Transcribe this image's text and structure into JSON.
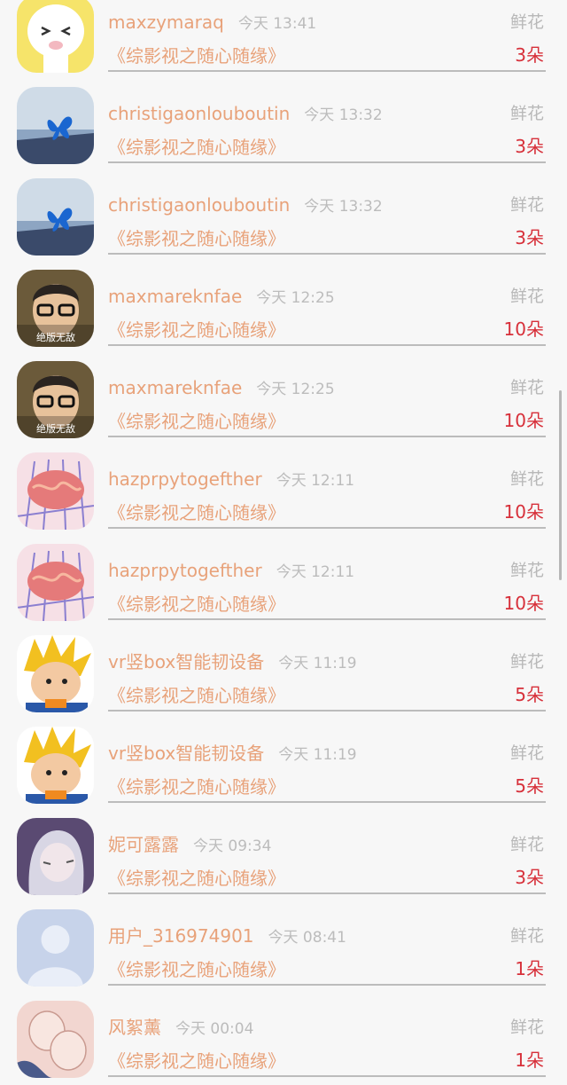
{
  "gifts": [
    {
      "name": "maxzymaraq",
      "time": "今天 13:41",
      "type": "鲜花",
      "work": "《综影视之随心随缘》",
      "count": "3朵",
      "avatar_icon": "cartoon-cat-avatar",
      "colors": [
        "#f6e46a",
        "#ffffff"
      ]
    },
    {
      "name": "christigaonlouboutin",
      "time": "今天 13:32",
      "type": "鲜花",
      "work": "《综影视之随心随缘》",
      "count": "3朵",
      "avatar_icon": "blue-butterfly-avatar",
      "colors": [
        "#cfdbe7",
        "#1a66d0"
      ]
    },
    {
      "name": "christigaonlouboutin",
      "time": "今天 13:32",
      "type": "鲜花",
      "work": "《综影视之随心随缘》",
      "count": "3朵",
      "avatar_icon": "blue-butterfly-avatar",
      "colors": [
        "#cfdbe7",
        "#1a66d0"
      ]
    },
    {
      "name": "maxmareknfae",
      "time": "今天 12:25",
      "type": "鲜花",
      "work": "《综影视之随心随缘》",
      "count": "10朵",
      "avatar_icon": "boy-glasses-avatar",
      "avatar_text": "绝版无敌",
      "colors": [
        "#6b5a3a",
        "#2a2420"
      ]
    },
    {
      "name": "maxmareknfae",
      "time": "今天 12:25",
      "type": "鲜花",
      "work": "《综影视之随心随缘》",
      "count": "10朵",
      "avatar_icon": "boy-glasses-avatar",
      "avatar_text": "绝版无敌",
      "colors": [
        "#6b5a3a",
        "#2a2420"
      ]
    },
    {
      "name": "hazprpytogefther",
      "time": "今天 12:11",
      "type": "鲜花",
      "work": "《综影视之随心随缘》",
      "count": "10朵",
      "avatar_icon": "noodle-bowl-avatar",
      "colors": [
        "#f6e0e6",
        "#e57a7a"
      ]
    },
    {
      "name": "hazprpytogefther",
      "time": "今天 12:11",
      "type": "鲜花",
      "work": "《综影视之随心随缘》",
      "count": "10朵",
      "avatar_icon": "noodle-bowl-avatar",
      "colors": [
        "#f6e0e6",
        "#e57a7a"
      ]
    },
    {
      "name": "vr竖box智能韧设备",
      "time": "今天 11:19",
      "type": "鲜花",
      "work": "《综影视之随心随缘》",
      "count": "5朵",
      "avatar_icon": "cartoon-goku-avatar",
      "colors": [
        "#f2c020",
        "#f3c9a2"
      ]
    },
    {
      "name": "vr竖box智能韧设备",
      "time": "今天 11:19",
      "type": "鲜花",
      "work": "《综影视之随心随缘》",
      "count": "5朵",
      "avatar_icon": "cartoon-goku-avatar",
      "colors": [
        "#f2c020",
        "#f3c9a2"
      ]
    },
    {
      "name": "妮可露露",
      "time": "今天 09:34",
      "type": "鲜花",
      "work": "《综影视之随心随缘》",
      "count": "3朵",
      "avatar_icon": "anime-girl-avatar",
      "colors": [
        "#5a4a72",
        "#d8d6e4"
      ]
    },
    {
      "name": "用户_316974901",
      "time": "今天 08:41",
      "type": "鲜花",
      "work": "《综影视之随心随缘》",
      "count": "1朵",
      "avatar_icon": "default-user-avatar",
      "colors": [
        "#c7d3ea",
        "#e9eef8"
      ]
    },
    {
      "name": "风絮薰",
      "time": "今天 00:04",
      "type": "鲜花",
      "work": "《综影视之随心随缘》",
      "count": "1朵",
      "avatar_icon": "sketch-couple-avatar",
      "colors": [
        "#f2d6d0",
        "#4a5a8a"
      ]
    }
  ]
}
